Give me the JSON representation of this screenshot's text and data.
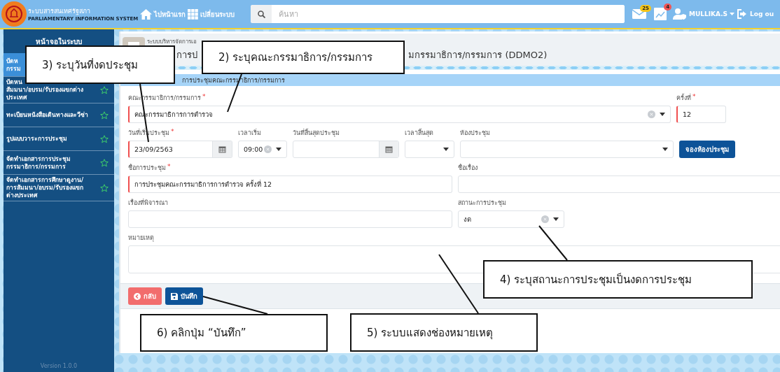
{
  "topbar": {
    "logo_title": "ระบบสารสนเทศรัฐสภา",
    "logo_subtitle": "PARLIAMENTARY INFORMATION SYSTEM",
    "nav": [
      {
        "label": "ไปหน้าแรก",
        "kind": "home"
      },
      {
        "label": "เปลี่ยนระบบ",
        "kind": "apps"
      }
    ],
    "search": {
      "placeholder": "ค้นหา"
    },
    "notifications": [
      {
        "kind": "mail",
        "badge": "25",
        "color": "#f5c518"
      },
      {
        "kind": "chart",
        "badge": "4",
        "color": "#f05454"
      }
    ],
    "user": "MULLIKA.S",
    "logout": "Log ou"
  },
  "sidebar": {
    "title": "หน้าจอในระบบ",
    "items": [
      {
        "label": "บัดห\nกรรม",
        "selected": true,
        "starred": false
      },
      {
        "label": "บัดหน\nสัมมนา/อบรม/รับรองแขกต่าง\nประเทศ",
        "selected": false,
        "starred": true
      },
      {
        "label": "ทะเบียนหนังสือเดินทางและวีซ่า",
        "selected": false,
        "starred": true
      },
      {
        "label": "รูปแบบวาระการประชุม",
        "selected": false,
        "starred": true
      },
      {
        "label": "จัดทำเอกสารการประชุม\nกรรมาธิการ/กรรมการ",
        "selected": false,
        "starred": true
      },
      {
        "label": "จัดทำเอกสารการศึกษาดูงาน/\nการสัมมนา/อบรม/รับรองแขก\nต่างประเทศ",
        "selected": false,
        "starred": true
      }
    ],
    "version": "Version 1.0.0"
  },
  "page": {
    "breadcrumb": "ระบบบริหารจัดการเอ",
    "title_start": "การป",
    "title_end": "มกรรมาธิการ/กรรมการ (DDMO2)",
    "section": "การประชุมคณะกรรมาธิการ/กรรมการ"
  },
  "form": {
    "committee": {
      "label": "คณะกรรมาธิการ/กรรมการ",
      "required_mark": "*",
      "value": "คณะกรรมาธิการการตำรวจ"
    },
    "session": {
      "label": "ครั้งที่",
      "required_mark": "*",
      "value": "12"
    },
    "start_date": {
      "label": "วันที่เริ่มประชุม",
      "required_mark": "*",
      "value": "23/09/2563"
    },
    "start_time": {
      "label": "เวลาเริ่ม",
      "value": "09:00"
    },
    "end_date": {
      "label": "วันที่สิ้นสุดประชุม"
    },
    "end_time": {
      "label": "เวลาสิ้นสุด"
    },
    "room": {
      "label": "ห้องประชุม"
    },
    "book_room_button": "จองห้องประชุม",
    "meeting_name": {
      "label": "ชื่อการประชุม",
      "required_mark": "*",
      "value": "การประชุมคณะกรรมาธิการการตำรวจ ครั้งที่ 12"
    },
    "subject": {
      "label": "ชื่อเรื่อง"
    },
    "agenda": {
      "label": "เรื่องที่พิจารณา"
    },
    "status": {
      "label": "สถานะการประชุม",
      "value": "งด"
    },
    "remark": {
      "label": "หมายเหตุ"
    }
  },
  "footer_buttons": [
    {
      "label": "กลับ",
      "kind": "back"
    },
    {
      "label": "บันทึก",
      "kind": "save"
    }
  ],
  "callouts": [
    {
      "text": "2) ระบุคณะกรรมาธิการ/กรรมการ"
    },
    {
      "text": "3) ระบุวันที่งดประชุม"
    },
    {
      "text": "4) ระบุสถานะการประชุมเป็นงดการประชุม"
    },
    {
      "text": "6) คลิกปุ่ม “บันทึก”"
    },
    {
      "text": "5) ระบบแสดงช่องหมายเหตุ"
    }
  ]
}
